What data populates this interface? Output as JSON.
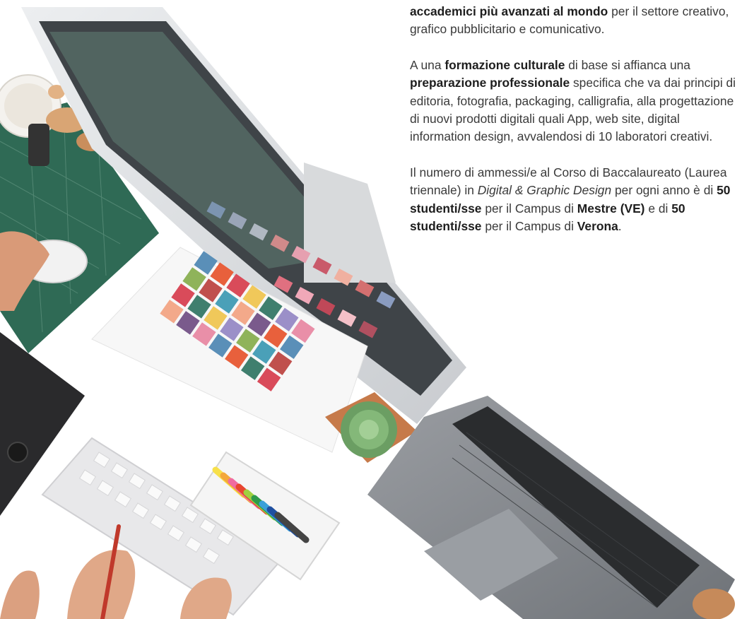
{
  "paragraphs": [
    {
      "runs": [
        {
          "t": "accademici più avanzati al mondo",
          "s": "b"
        },
        {
          "t": " per il settore creativo, grafico pubblicitario e comunicativo.",
          "s": ""
        }
      ]
    },
    {
      "runs": [
        {
          "t": "A una ",
          "s": ""
        },
        {
          "t": "formazione culturale",
          "s": "b"
        },
        {
          "t": " di base si affianca una ",
          "s": ""
        },
        {
          "t": "preparazione professionale",
          "s": "b"
        },
        {
          "t": " specifica che va dai principi di editoria, fotografia, packaging, calligrafia, alla progettazione di nuovi prodotti digitali quali App, web site, digital information design, avvalendosi di 10 laboratori creativi.",
          "s": ""
        }
      ]
    },
    {
      "runs": [
        {
          "t": "Il numero di ammessi/e al Corso di Baccalaureato (Laurea triennale) in ",
          "s": ""
        },
        {
          "t": "Digital & Graphic Design",
          "s": "i"
        },
        {
          "t": " per ogni anno è di ",
          "s": ""
        },
        {
          "t": "50 studenti/sse",
          "s": "b"
        },
        {
          "t": " per il Campus di ",
          "s": ""
        },
        {
          "t": "Mestre (VE)",
          "s": "b"
        },
        {
          "t": " e di ",
          "s": ""
        },
        {
          "t": "50 studenti/sse",
          "s": "b"
        },
        {
          "t": " per il Campus di ",
          "s": ""
        },
        {
          "t": "Verona",
          "s": "b"
        },
        {
          "t": ".",
          "s": ""
        }
      ]
    }
  ],
  "colors": {
    "text": "#3a3a3a",
    "emphasis": "#1e1e1e",
    "mat": "#2f6a55",
    "swatches": [
      "#5a8fb8",
      "#e8603c",
      "#d94b5a",
      "#f0c85a",
      "#3f7f6e",
      "#9b8fc8",
      "#e98fa8",
      "#8fb35a",
      "#c0504d",
      "#4aa0b8",
      "#f3a98a",
      "#7a5a8c"
    ],
    "pastels": [
      "#f7e04a",
      "#f4a83a",
      "#f06ba0",
      "#e8452f",
      "#a0d040",
      "#2f9a4a",
      "#3aa0d8",
      "#1f4fa0",
      "#444444"
    ]
  },
  "hero_image": {
    "icon": "designer-desk-photo-image"
  }
}
